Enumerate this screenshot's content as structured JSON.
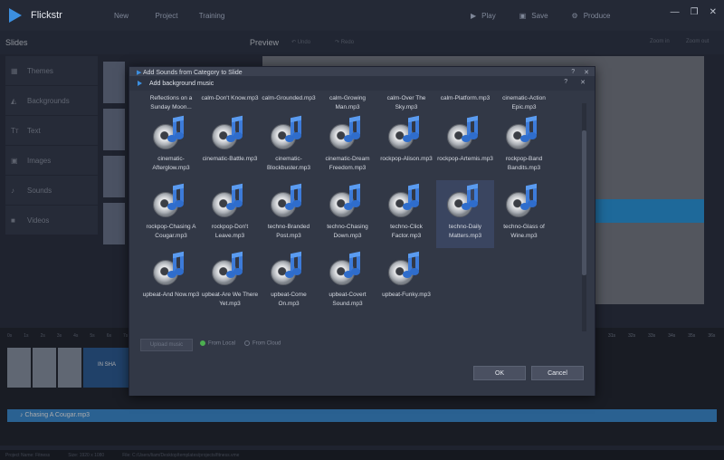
{
  "app": {
    "title": "Flickstr"
  },
  "topmenu": [
    "New",
    "Project",
    "Training"
  ],
  "topactions": {
    "play": "Play",
    "save": "Save",
    "produce": "Produce"
  },
  "window_controls": {
    "minimize": "—",
    "maximize": "❐",
    "close": "✕"
  },
  "slides_bar": {
    "slides": "Slides",
    "preview": "Preview",
    "undo": "Undo",
    "redo": "Redo",
    "zoom_in": "Zoom in",
    "zoom_out": "Zoom out"
  },
  "sidebar": {
    "items": [
      {
        "label": "Themes",
        "icon": "themes-icon"
      },
      {
        "label": "Backgrounds",
        "icon": "backgrounds-icon"
      },
      {
        "label": "Text",
        "icon": "text-icon"
      },
      {
        "label": "Images",
        "icon": "images-icon"
      },
      {
        "label": "Sounds",
        "icon": "sounds-icon"
      },
      {
        "label": "Videos",
        "icon": "videos-icon"
      }
    ]
  },
  "timeline": {
    "ticks": [
      "0s",
      "1s",
      "2s",
      "3s",
      "4s",
      "5s",
      "6s",
      "7s",
      "8s",
      "9s",
      "10s"
    ],
    "right_ticks": [
      "31s",
      "32s",
      "33s",
      "34s",
      "35s",
      "36s"
    ],
    "clip_label": "IN SHA"
  },
  "audio_track": {
    "label": "Chasing A Cougar.mp3"
  },
  "statusbar": {
    "project": "Project Name: Fitness",
    "size": "Size: 1920 x 1080",
    "file": "File: C:/Users/liam/Desktop/templates/projects/fitness.vme"
  },
  "outer_dialog": {
    "title": "Add Sounds from Category to Slide",
    "help": "?",
    "close": "✕"
  },
  "inner_dialog": {
    "title": "Add background music",
    "help": "?",
    "close": "✕"
  },
  "files_top": [
    "Reflections on a Sunday Moon...",
    "calm-Don't Know.mp3",
    "calm-Grounded.mp3",
    "calm-Growing Man.mp3",
    "calm-Over The Sky.mp3",
    "calm-Platform.mp3",
    "cinematic-Action Epic.mp3"
  ],
  "files": [
    "cinematic-Afterglow.mp3",
    "cinematic-Battle.mp3",
    "cinematic-Blockbuster.mp3",
    "cinematic-Dream Freedom.mp3",
    "rockpop-Alison.mp3",
    "rockpop-Artemis.mp3",
    "rockpop-Band Bandits.mp3",
    "rockpop-Chasing A Cougar.mp3",
    "rockpop-Don't Leave.mp3",
    "techno-Branded Post.mp3",
    "techno-Chasing Down.mp3",
    "techno-Click Factor.mp3",
    "techno-Daily Matters.mp3",
    "techno-Glass of Wine.mp3",
    "upbeat-And Now.mp3",
    "upbeat-Are We There Yet.mp3",
    "upbeat-Come On.mp3",
    "upbeat-Covert Sound.mp3",
    "upbeat-Funky.mp3"
  ],
  "selected_index": 12,
  "dialog_footer": {
    "upload": "Upload music",
    "from_local": "From Local",
    "from_cloud": "From Cloud",
    "ok": "OK",
    "cancel": "Cancel"
  }
}
